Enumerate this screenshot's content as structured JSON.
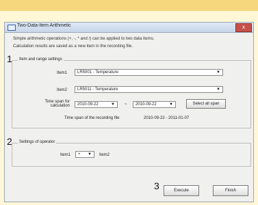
{
  "window": {
    "title": "Two-Data-Item Arithmetic",
    "close_label": "x"
  },
  "description": {
    "line1": "Simple arithmetic operations (+, -, * and /) can be applied to two data items.",
    "line2": "Calculation results are saved as a new item in the recording file."
  },
  "markers": {
    "m1": "1",
    "m2": "2",
    "m3": "3"
  },
  "item_group": {
    "title": "Item and range settings",
    "item1_label": "Item1",
    "item1_value": "LR5001 - Temperature",
    "item2_label": "Item2",
    "item2_value": "LR5011 - Temperature",
    "timespan_label_line1": "Time span for",
    "timespan_label_line2": "calculation",
    "start_date": "2010-09-22",
    "tilde": "~",
    "end_date": "2010-09-22",
    "select_all_label": "Select all span",
    "recording_span_label": "Time span of the recording file",
    "recording_span_value": "2010-09-22 - 2011-01-07"
  },
  "operator_group": {
    "title": "Settings of operator",
    "item1_label": "Item1",
    "operator_value": "+",
    "item2_label": "Item2"
  },
  "buttons": {
    "execute": "Execute",
    "finish": "Finish"
  },
  "colors": {
    "accent_arrow": "#f2a020",
    "close_button": "#c7504b",
    "background_band": "#f6d77d"
  }
}
